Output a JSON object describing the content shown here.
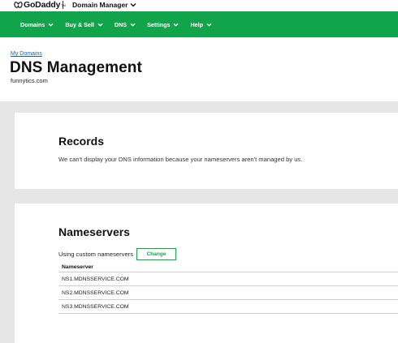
{
  "header": {
    "logo_text": "GoDaddy",
    "logo_tm": "TM",
    "product_menu": "Domain Manager"
  },
  "nav": {
    "items": [
      {
        "label": "Domains"
      },
      {
        "label": "Buy & Sell"
      },
      {
        "label": "DNS"
      },
      {
        "label": "Settings"
      },
      {
        "label": "Help"
      }
    ]
  },
  "page": {
    "breadcrumb": "My Domains",
    "title": "DNS Management",
    "domain": "funnytics.com"
  },
  "records": {
    "title": "Records",
    "message": "We can't display your DNS information because your nameservers aren't managed by us."
  },
  "nameservers": {
    "title": "Nameservers",
    "using_text": "Using custom nameservers",
    "change_label": "Change",
    "column_header": "Nameserver",
    "rows": [
      "NS1.MDNSSERVICE.COM",
      "NS2.MDNSSERVICE.COM",
      "NS3.MDNSSERVICE.COM"
    ]
  },
  "colors": {
    "brand_green": "#12a44a",
    "link_blue": "#1b5fa8",
    "page_grey": "#e6e6e6"
  }
}
